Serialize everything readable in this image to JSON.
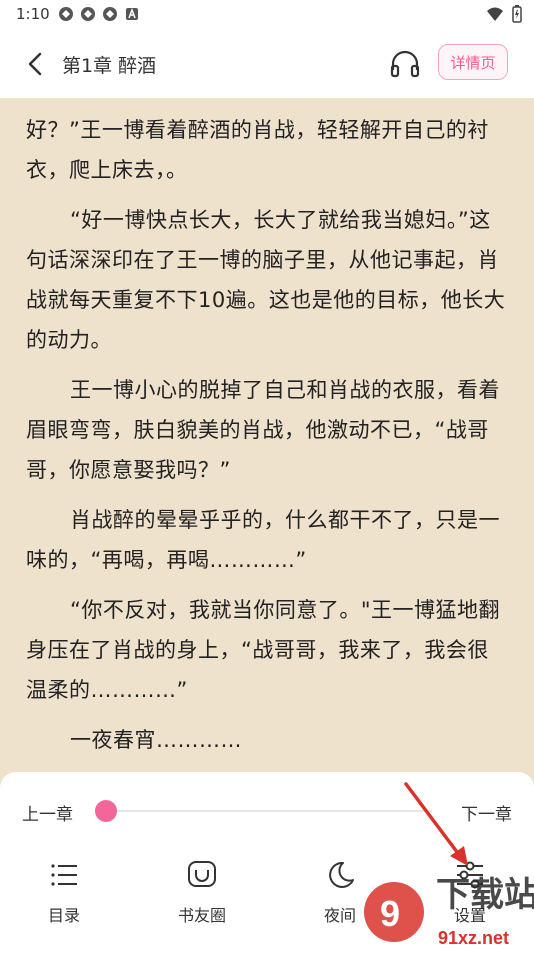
{
  "status_bar": {
    "time": "1:10"
  },
  "header": {
    "chapter_title": "第1章  醉酒",
    "detail_label": "详情页"
  },
  "reader": {
    "paragraphs": [
      {
        "text": "好？”王一博看着醉酒的肖战，轻轻解开自己的衬衣，爬上床去，。",
        "indent": false
      },
      {
        "text": "“好一博快点长大，长大了就给我当媳妇。”这句话深深印在了王一博的脑子里，从他记事起，肖战就每天重复不下10遍。这也是他的目标，他长大的动力。",
        "indent": true
      },
      {
        "text": "王一博小心的脱掉了自己和肖战的衣服，看着眉眼弯弯，肤白貌美的肖战，他激动不已，“战哥哥，你愿意娶我吗？”",
        "indent": true
      },
      {
        "text": "肖战醉的晕晕乎乎的，什么都干不了，只是一味的，“再喝，再喝…………”",
        "indent": true
      },
      {
        "text": "“你不反对，我就当你同意了。\"王一博猛地翻身压在了肖战的身上，“战哥哥，我来了，我会很温柔的…………”",
        "indent": true
      },
      {
        "text": "一夜春宵…………",
        "indent": true
      }
    ]
  },
  "panel": {
    "prev_label": "上一章",
    "next_label": "下一章",
    "progress_fraction": 0.0,
    "tabs": [
      {
        "label": "目录",
        "icon": "menu-list-icon"
      },
      {
        "label": "书友圈",
        "icon": "chat-bubble-icon"
      },
      {
        "label": "夜间",
        "icon": "moon-icon"
      },
      {
        "label": "设置",
        "icon": "settings-sliders-icon"
      }
    ]
  },
  "watermark": {
    "line1": "下载站",
    "line2": "91xz.net"
  },
  "colors": {
    "reader_bg": "#efe2cd",
    "accent": "#f4669a",
    "annotation_arrow": "#d9322b"
  }
}
